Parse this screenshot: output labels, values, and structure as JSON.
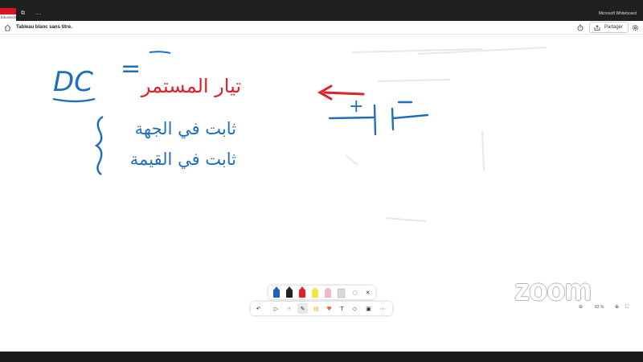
{
  "window": {
    "app_name": "Microsoft Whiteboard",
    "logo_caption": "Eduvision",
    "back_glyph": "⧉",
    "more_glyph": "…"
  },
  "toolbar": {
    "title": "Tableau blanc sans titre",
    "title_chevron": "⌄",
    "share_label": "Partager"
  },
  "whiteboard": {
    "dc_label": "DC",
    "equals": "=",
    "arabic_title": "تيار المستمر",
    "arabic_line_1": "ثابت في الجهة",
    "arabic_line_2": "ثابت في القيمة",
    "battery_plus": "+",
    "colors": {
      "blue_ink": "#1e6fbf",
      "red_ink": "#e0202a",
      "faint": "#e6e6e6"
    }
  },
  "pen_tray": {
    "pens": [
      {
        "name": "blue-pen",
        "color": "#1e5fbf"
      },
      {
        "name": "black-pen",
        "color": "#222222"
      },
      {
        "name": "red-pen",
        "color": "#e0202a"
      },
      {
        "name": "yellow-highlighter",
        "color": "#f2e64a"
      },
      {
        "name": "pink-highlighter",
        "color": "#f0b8c8"
      },
      {
        "name": "eraser",
        "color": "#d8d8d8"
      }
    ],
    "lasso_glyph": "◌",
    "close_glyph": "✕"
  },
  "main_tools": {
    "undo": "↶",
    "select": "▷",
    "touch": "☝",
    "pen": "✎",
    "note": "▤",
    "reaction": "♥",
    "text": "T",
    "shapes": "◇",
    "image": "▣",
    "more": "⋯"
  },
  "zoom": {
    "zoom_out": "⊖",
    "level": "83 %",
    "zoom_in": "⊕",
    "fit": "⛶"
  },
  "watermark": "zoom"
}
